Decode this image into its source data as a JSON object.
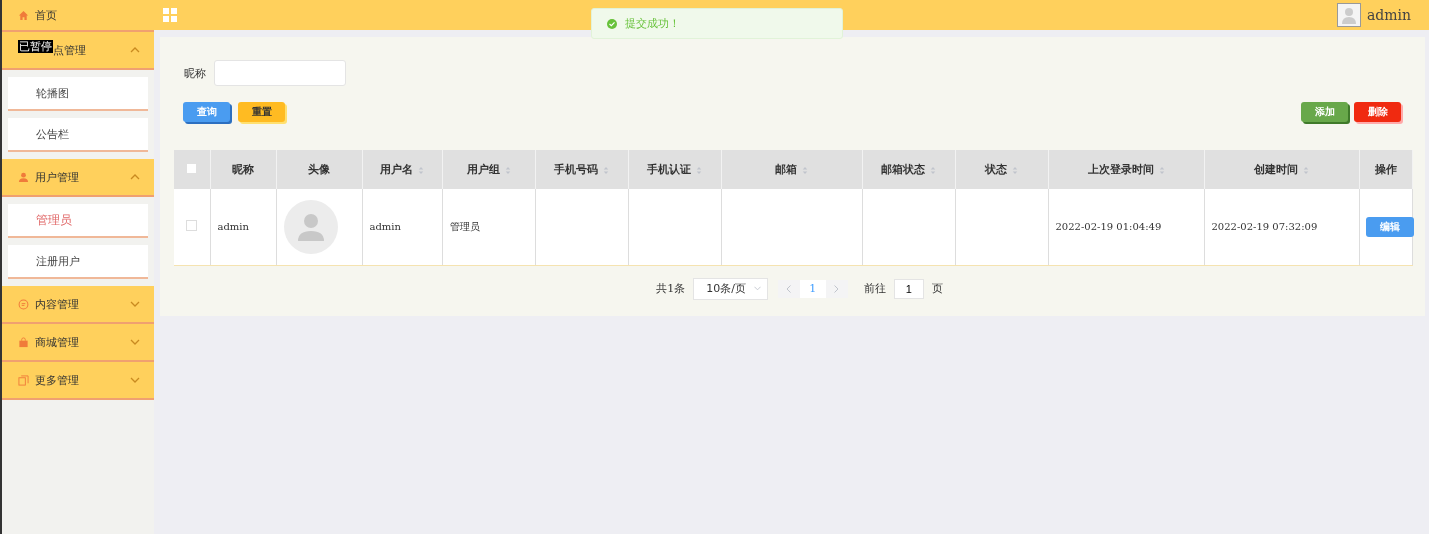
{
  "sidebar": {
    "home": {
      "label": "首页"
    },
    "groups": [
      {
        "label": "点管理",
        "expanded": true,
        "children": [
          {
            "label": "轮播图",
            "selected": false
          },
          {
            "label": "公告栏",
            "selected": false
          }
        ]
      },
      {
        "label": "用户管理",
        "expanded": true,
        "children": [
          {
            "label": "管理员",
            "selected": true
          },
          {
            "label": "注册用户",
            "selected": false
          }
        ]
      },
      {
        "label": "内容管理",
        "expanded": false
      },
      {
        "label": "商城管理",
        "expanded": false
      },
      {
        "label": "更多管理",
        "expanded": false
      }
    ],
    "overlay": "已暂停"
  },
  "topbar": {
    "user": "admin"
  },
  "toast": {
    "message": "提交成功！"
  },
  "search": {
    "label": "昵称"
  },
  "buttons": {
    "query": "查询",
    "reset": "重置",
    "add": "添加",
    "delete": "删除"
  },
  "table": {
    "all_checked": false,
    "columns": [
      {
        "label": "昵称",
        "sortable": false
      },
      {
        "label": "头像",
        "sortable": false
      },
      {
        "label": "用户名",
        "sortable": true
      },
      {
        "label": "用户组",
        "sortable": true
      },
      {
        "label": "手机号码",
        "sortable": true
      },
      {
        "label": "手机认证",
        "sortable": true
      },
      {
        "label": "邮箱",
        "sortable": true
      },
      {
        "label": "邮箱状态",
        "sortable": true
      },
      {
        "label": "状态",
        "sortable": true
      },
      {
        "label": "上次登录时间",
        "sortable": true
      },
      {
        "label": "创建时间",
        "sortable": true
      },
      {
        "label": "操作",
        "sortable": false
      }
    ],
    "rows": [
      {
        "checked": false,
        "cells": [
          "admin",
          null,
          "admin",
          "管理员",
          "",
          "",
          "",
          "",
          "",
          "2022-02-19 01:04:49",
          "2022-02-19 07:32:09"
        ],
        "action": "编辑"
      }
    ]
  },
  "pagination": {
    "total": "共1条",
    "page_size": "10条/页",
    "pages": [
      {
        "label": "1",
        "selected": true
      }
    ],
    "goto_label": "前往",
    "goto_value": "1",
    "goto_suffix": "页"
  }
}
